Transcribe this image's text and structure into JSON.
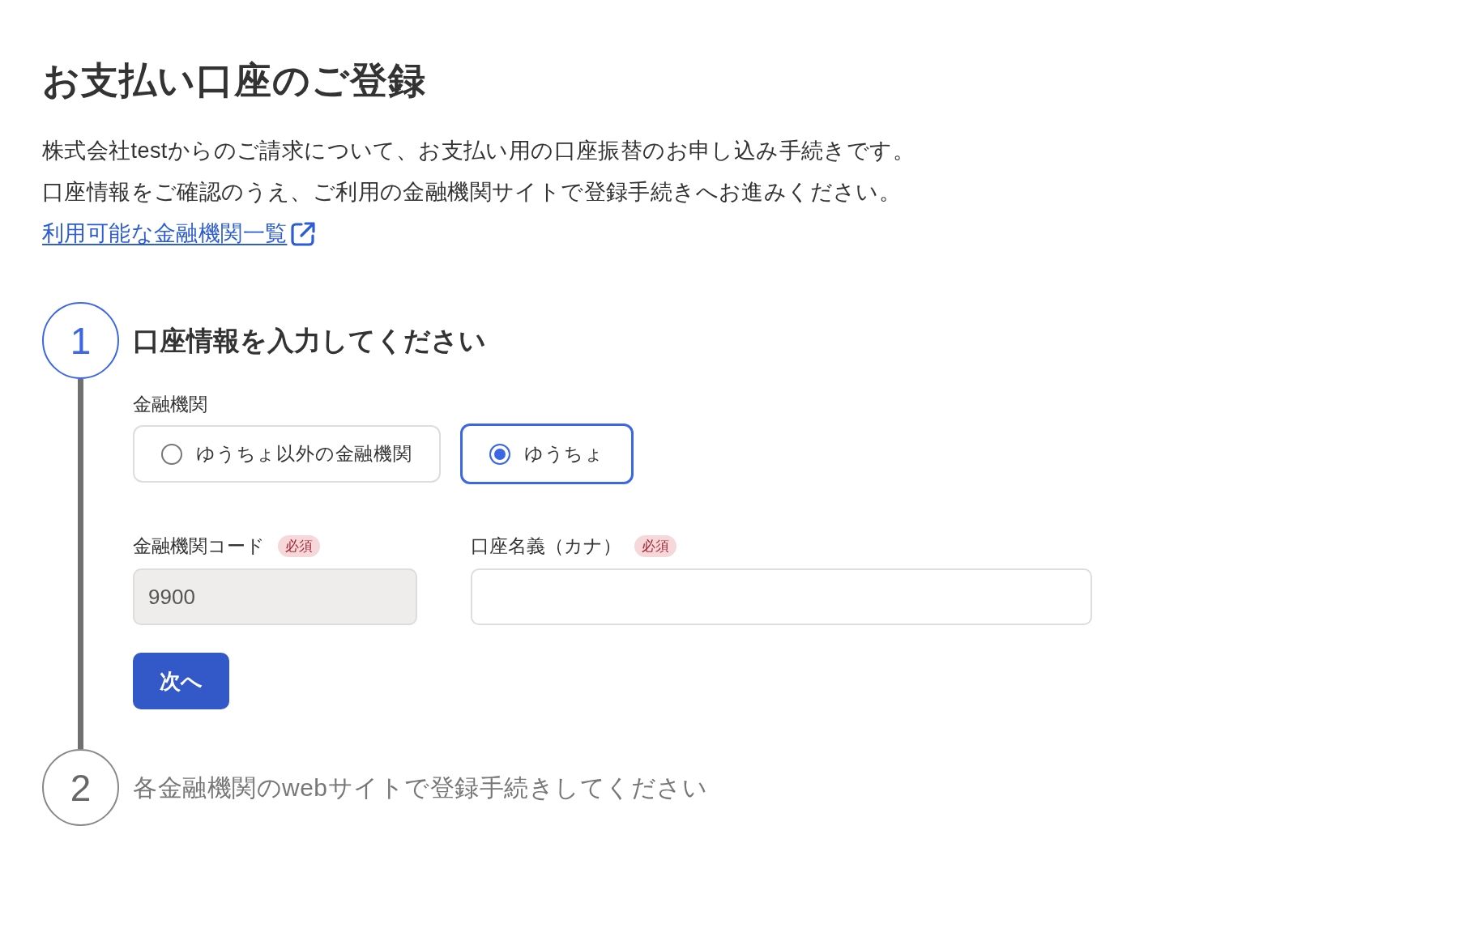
{
  "title": "お支払い口座のご登録",
  "description": [
    "株式会社testからのご請求について、お支払い用の口座振替のお申し込み手続きです。",
    "口座情報をご確認のうえ、ご利用の金融機関サイトで登録手続きへお進みください。"
  ],
  "link": {
    "label": "利用可能な金融機関一覧"
  },
  "steps": [
    {
      "number": "1",
      "title": "口座情報を入力してください",
      "active": true,
      "bank_type": {
        "label": "金融機関",
        "options": [
          {
            "label": "ゆうちょ以外の金融機関",
            "selected": false
          },
          {
            "label": "ゆうちょ",
            "selected": true
          }
        ]
      },
      "fields": [
        {
          "label": "金融機関コード",
          "badge": "必須",
          "value": "9900",
          "disabled": true
        },
        {
          "label": "口座名義（カナ）",
          "badge": "必須",
          "disabled": false
        }
      ],
      "button": {
        "label": "次へ"
      }
    },
    {
      "number": "2",
      "title": "各金融機関のwebサイトで登録手続きしてください",
      "active": false
    }
  ]
}
